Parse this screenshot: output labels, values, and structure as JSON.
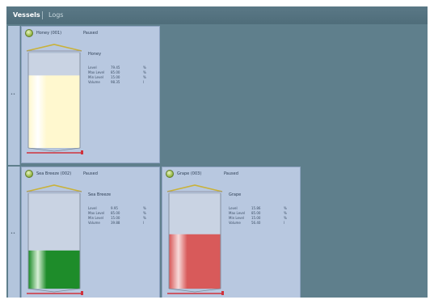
{
  "tabs": [
    {
      "label": "Vessels",
      "active": true
    },
    {
      "label": "Logs",
      "active": false
    }
  ],
  "rows": [
    {
      "label": "••"
    },
    {
      "label": "••"
    }
  ],
  "colors": {
    "background": "#5f7f8c",
    "panel": "#b8c8e0",
    "status_ok": "#8fb13c",
    "roof": "#c9b23a",
    "base_line": "#d0323c"
  },
  "vessels": [
    {
      "name": "Honey (001)",
      "status": "Paused",
      "status_icon": "status-ok-icon",
      "product": "Honey",
      "fill_fraction": 0.76,
      "fill_color": "#fff8cf",
      "fill_highlight": "#ffffff",
      "readings": [
        {
          "label": "Level",
          "value": "79.45",
          "unit": "%"
        },
        {
          "label": "Max Level",
          "value": "85.00",
          "unit": "%"
        },
        {
          "label": "Min Level",
          "value": "15.00",
          "unit": "%"
        },
        {
          "label": "Volume",
          "value": "98.35",
          "unit": "l"
        }
      ]
    },
    {
      "name": "Sea Breeze (002)",
      "status": "Paused",
      "status_icon": "status-ok-icon",
      "product": "Sea Breeze",
      "fill_fraction": 0.4,
      "fill_color": "#1e8c2a",
      "fill_highlight": "#d8efd6",
      "readings": [
        {
          "label": "Level",
          "value": "9.95",
          "unit": "%"
        },
        {
          "label": "Max Level",
          "value": "85.00",
          "unit": "%"
        },
        {
          "label": "Min Level",
          "value": "15.00",
          "unit": "%"
        },
        {
          "label": "Volume",
          "value": "39.88",
          "unit": "l"
        }
      ]
    },
    {
      "name": "Grape (003)",
      "status": "Paused",
      "status_icon": "status-ok-icon",
      "product": "Grape",
      "fill_fraction": 0.57,
      "fill_color": "#d85a5a",
      "fill_highlight": "#f7dada",
      "readings": [
        {
          "label": "Level",
          "value": "15.86",
          "unit": "%"
        },
        {
          "label": "Max Level",
          "value": "85.00",
          "unit": "%"
        },
        {
          "label": "Min Level",
          "value": "15.00",
          "unit": "%"
        },
        {
          "label": "Volume",
          "value": "56.40",
          "unit": "l"
        }
      ]
    }
  ]
}
